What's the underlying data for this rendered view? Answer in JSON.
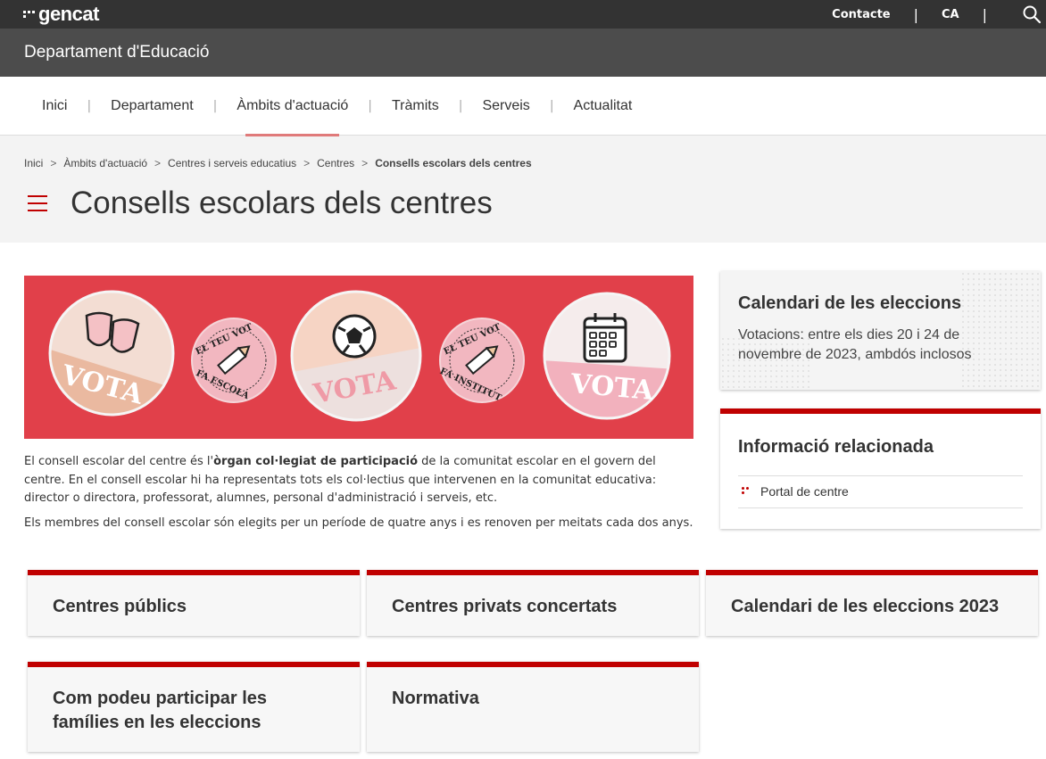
{
  "topbar": {
    "logo_text": "gencat",
    "contact": "Contacte",
    "language": "CA"
  },
  "dept": {
    "name": "Departament d'Educació"
  },
  "nav": {
    "items": [
      "Inici",
      "Departament",
      "Àmbits d'actuació",
      "Tràmits",
      "Serveis",
      "Actualitat"
    ]
  },
  "breadcrumb": {
    "items": [
      "Inici",
      "Àmbits d'actuació",
      "Centres i serveis educatius",
      "Centres"
    ],
    "current": "Consells escolars dels centres"
  },
  "page": {
    "title": "Consells escolars dels centres"
  },
  "banner": {
    "badges": [
      "VOTA",
      "EL TEU VOT",
      "FA ESCOLA",
      "VOTA",
      "EL TEU VOT",
      "FA INSTITUT",
      "VOTA"
    ]
  },
  "intro": {
    "p1_a": "El consell escolar del centre és l'",
    "p1_b": "òrgan col·legiat de participació",
    "p1_c": " de la comunitat escolar en el govern del centre. En el consell escolar hi ha representats tots els col·lectius que intervenen en la comunitat educativa: director o directora, professorat, alumnes, personal d'administració i serveis, etc.",
    "p2": "Els membres del consell escolar són elegits per un període de quatre anys i es renoven per meitats cada dos anys."
  },
  "sidebar": {
    "calendar_title": "Calendari de les eleccions",
    "calendar_text": "Votacions: entre els dies 20 i 24 de novembre de 2023, ambdós inclosos",
    "related_title": "Informació relacionada",
    "related_link": "Portal de centre"
  },
  "tiles": [
    "Centres públics",
    "Centres privats concertats",
    "Calendari de les eleccions 2023",
    "Com podeu participar les famílies en les eleccions",
    "Normativa"
  ],
  "colors": {
    "accent": "#c00000",
    "banner": "#e1404a",
    "topbar": "#333333",
    "deptbar": "#4c4c4c"
  }
}
